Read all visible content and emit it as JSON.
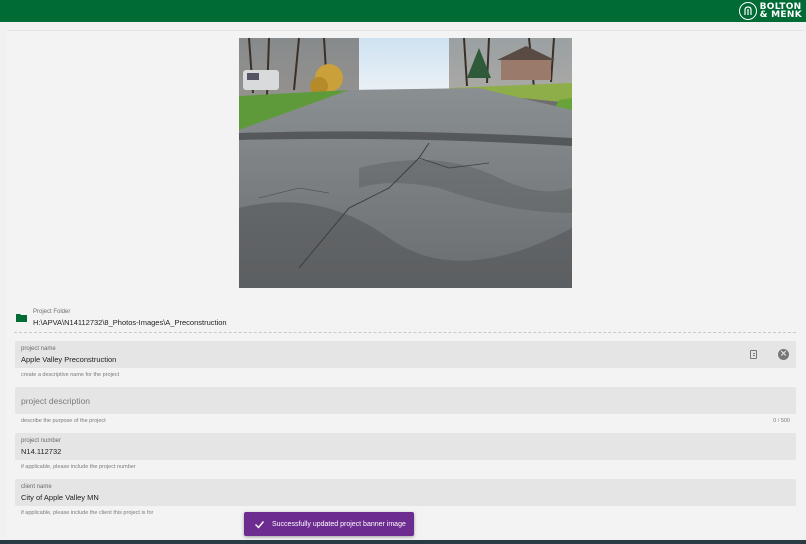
{
  "brand": {
    "line1": "BOLTON",
    "line2": "& MENK",
    "color": "#006b35"
  },
  "banner_image": {
    "alt": ""
  },
  "folder": {
    "label": "Project Folder",
    "path": "H:\\APVA\\N14112732\\8_Photos-Images\\A_Preconstruction",
    "icon": "folder-icon"
  },
  "fields": {
    "project_name": {
      "label": "project name",
      "value": "Apple Valley Preconstruction",
      "hint": "create a descriptive name for the project"
    },
    "project_description": {
      "placeholder": "project description",
      "hint": "describe the purpose of the project",
      "counter": "0 / 500"
    },
    "project_number": {
      "label": "project number",
      "value": "N14.112732",
      "hint": "if applicable, please include the project number"
    },
    "client_name": {
      "label": "client name",
      "value": "City of Apple Valley MN",
      "hint": "if applicable, please include the client this project is for"
    }
  },
  "toast": {
    "message": "Successfully updated project banner image",
    "color": "#6d2c8f"
  }
}
